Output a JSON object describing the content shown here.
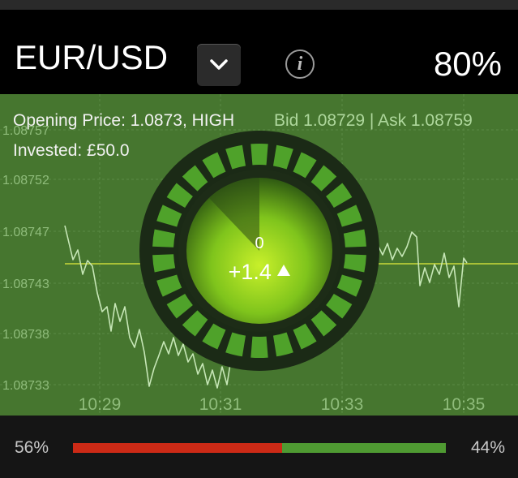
{
  "header": {
    "pair": "EUR/USD",
    "payout": "80%",
    "dropdown_icon": "chevron-down-icon",
    "info_icon": "info-icon",
    "info_glyph": "i"
  },
  "trade": {
    "opening_price": "Opening Price: 1.0873, HIGH",
    "bid_ask": "Bid 1.08729 | Ask 1.08759",
    "invested": "Invested: £50.0"
  },
  "dial": {
    "timer_value": "0",
    "change": "+1.4",
    "direction_icon": "triangle-up-icon"
  },
  "axes": {
    "y_ticks": [
      "1.08757",
      "1.08752",
      "1.08747",
      "1.08743",
      "1.08738",
      "1.08733"
    ],
    "x_ticks": [
      "10:29",
      "10:31",
      "10:33",
      "10:35"
    ]
  },
  "sentiment": {
    "left_pct": "56%",
    "right_pct": "44%",
    "left_value": 0.56,
    "left_color": "#cc2a16",
    "right_color": "#4f9a32"
  },
  "colors": {
    "chart_bg": "#46762f",
    "price_line": "#c6e6b6",
    "reference_line": "#c9d93a"
  }
}
